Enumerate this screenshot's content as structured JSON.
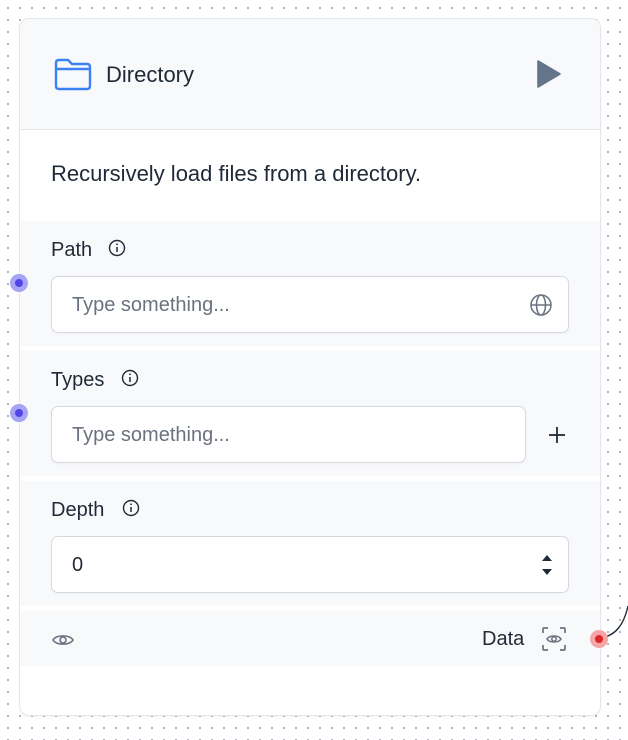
{
  "node": {
    "title": "Directory",
    "description": "Recursively load files from a directory.",
    "icon": "folder-icon",
    "accent_color": "#3b82f6"
  },
  "params": {
    "path": {
      "label": "Path",
      "placeholder": "Type something..."
    },
    "types": {
      "label": "Types",
      "placeholder": "Type something..."
    },
    "depth": {
      "label": "Depth",
      "value": "0"
    }
  },
  "output": {
    "label": "Data"
  },
  "colors": {
    "input_handle": "#4f46e5",
    "output_handle": "#dc2626",
    "edge": "#1f2937"
  }
}
